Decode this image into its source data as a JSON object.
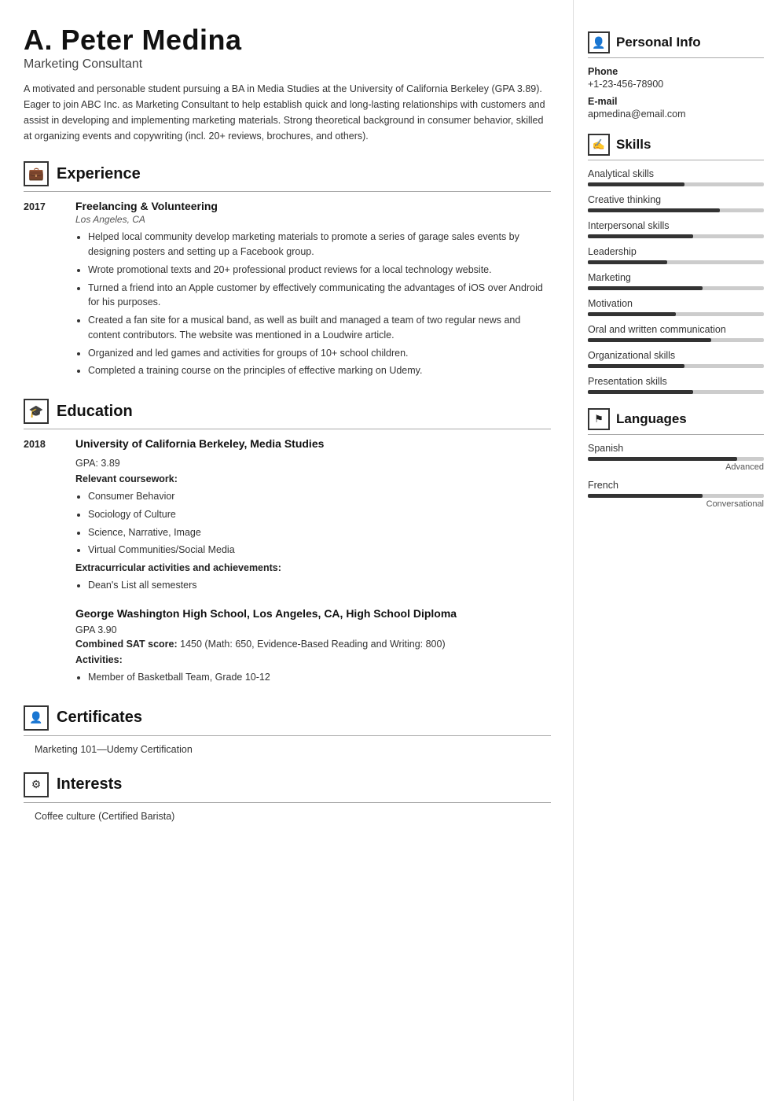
{
  "header": {
    "name": "A. Peter Medina",
    "title": "Marketing Consultant",
    "bio": "A motivated and personable student pursuing a BA in Media Studies at the University of California Berkeley (GPA 3.89). Eager to join ABC Inc. as Marketing Consultant to help establish quick and long-lasting relationships with customers and assist in developing and implementing marketing materials. Strong theoretical background in consumer behavior, skilled at organizing events and copywriting (incl. 20+ reviews, brochures, and others)."
  },
  "sections": {
    "experience": {
      "title": "Experience",
      "icon": "💼",
      "entries": [
        {
          "year": "2017",
          "title": "Freelancing & Volunteering",
          "subtitle": "Los Angeles, CA",
          "bullets": [
            "Helped local community develop marketing materials to promote a series of garage sales events by designing posters and setting up a Facebook group.",
            "Wrote promotional texts and 20+ professional product reviews for a local technology website.",
            "Turned a friend into an Apple customer by effectively communicating the advantages of iOS over Android for his purposes.",
            "Created a fan site for a musical band, as well as built and managed a team of two regular news and content contributors. The website was mentioned in a Loudwire article.",
            "Organized and led games and activities for groups of 10+ school children.",
            "Completed a training course on the principles of effective marking on Udemy."
          ]
        }
      ]
    },
    "education": {
      "title": "Education",
      "icon": "🎓",
      "entries": [
        {
          "year": "2018",
          "title": "University of California Berkeley, Media Studies",
          "subtitle": "",
          "gpa": "GPA: 3.89",
          "coursework_label": "Relevant coursework:",
          "coursework": [
            "Consumer Behavior",
            "Sociology of Culture",
            "Science, Narrative, Image",
            "Virtual Communities/Social Media"
          ],
          "extracurricular_label": "Extracurricular activities and achievements:",
          "extracurricular": [
            "Dean's List all semesters"
          ]
        },
        {
          "year": "",
          "title": "George Washington High School, Los Angeles, CA, High School Diploma",
          "subtitle": "",
          "gpa": "GPA 3.90",
          "sat_label": "Combined SAT score:",
          "sat_value": "1450 (Math: 650, Evidence-Based Reading and Writing: 800)",
          "activities_label": "Activities:",
          "activities": [
            "Member of Basketball Team, Grade 10-12"
          ]
        }
      ]
    },
    "certificates": {
      "title": "Certificates",
      "icon": "📜",
      "items": [
        "Marketing 101—Udemy Certification"
      ]
    },
    "interests": {
      "title": "Interests",
      "icon": "🎯",
      "items": [
        "Coffee culture (Certified Barista)"
      ]
    }
  },
  "right": {
    "personal_info": {
      "title": "Personal Info",
      "icon": "👤",
      "phone_label": "Phone",
      "phone": "+1-23-456-78900",
      "email_label": "E-mail",
      "email": "apmedina@email.com"
    },
    "skills": {
      "title": "Skills",
      "icon": "✋",
      "items": [
        {
          "name": "Analytical skills",
          "level": 55
        },
        {
          "name": "Creative thinking",
          "level": 75
        },
        {
          "name": "Interpersonal skills",
          "level": 60
        },
        {
          "name": "Leadership",
          "level": 45
        },
        {
          "name": "Marketing",
          "level": 65
        },
        {
          "name": "Motivation",
          "level": 50
        },
        {
          "name": "Oral and written communication",
          "level": 70
        },
        {
          "name": "Organizational skills",
          "level": 55
        },
        {
          "name": "Presentation skills",
          "level": 60
        }
      ]
    },
    "languages": {
      "title": "Languages",
      "icon": "🚩",
      "items": [
        {
          "name": "Spanish",
          "level": 85,
          "label": "Advanced"
        },
        {
          "name": "French",
          "level": 65,
          "label": "Conversational"
        }
      ]
    }
  }
}
